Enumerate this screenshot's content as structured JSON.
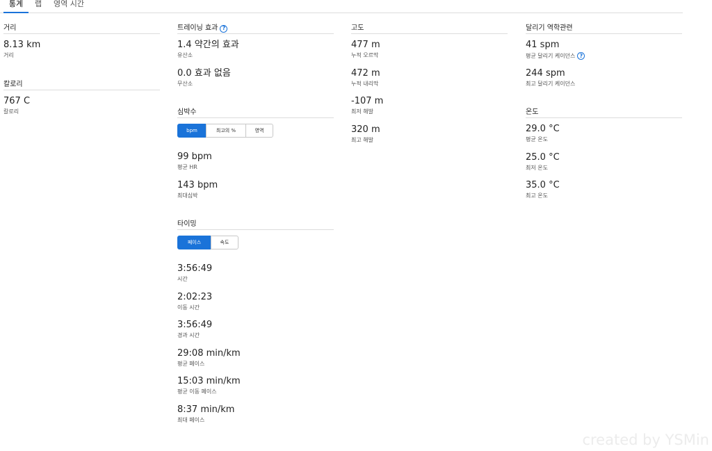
{
  "tabs": [
    {
      "label": "통계",
      "active": true
    },
    {
      "label": "랩",
      "active": false
    },
    {
      "label": "영역 시간",
      "active": false
    }
  ],
  "distance": {
    "title": "거리",
    "value": "8.13 km",
    "label": "거리"
  },
  "calories": {
    "title": "칼로리",
    "value": "767 C",
    "label": "칼로리"
  },
  "training": {
    "title": "트레이닝 효과",
    "help_icon": "question-circle-icon",
    "items": [
      {
        "value": "1.4 약간의 효과",
        "label": "유산소"
      },
      {
        "value": "0.0 효과 없음",
        "label": "무산소"
      }
    ]
  },
  "heart_rate": {
    "title": "심박수",
    "toggle": [
      {
        "label": "bpm",
        "active": true
      },
      {
        "label": "최고의 %",
        "active": false
      },
      {
        "label": "영역",
        "active": false
      }
    ],
    "items": [
      {
        "value": "99 bpm",
        "label": "평균 HR"
      },
      {
        "value": "143 bpm",
        "label": "최대심박"
      }
    ]
  },
  "timing": {
    "title": "타이밍",
    "toggle": [
      {
        "label": "페이스",
        "active": true
      },
      {
        "label": "속도",
        "active": false
      }
    ],
    "items": [
      {
        "value": "3:56:49",
        "label": "시간"
      },
      {
        "value": "2:02:23",
        "label": "이동 시간"
      },
      {
        "value": "3:56:49",
        "label": "경과 시간"
      },
      {
        "value": "29:08 min/km",
        "label": "평균 페이스"
      },
      {
        "value": "15:03 min/km",
        "label": "평균 이동 페이스"
      },
      {
        "value": "8:37 min/km",
        "label": "최대 페이스"
      }
    ]
  },
  "elevation": {
    "title": "고도",
    "items": [
      {
        "value": "477 m",
        "label": "누적 오르막"
      },
      {
        "value": "472 m",
        "label": "누적 내리막"
      },
      {
        "value": "-107 m",
        "label": "최저 해발"
      },
      {
        "value": "320 m",
        "label": "최고 해발"
      }
    ]
  },
  "dynamics": {
    "title": "달리기 역학관련",
    "items": [
      {
        "value": "41 spm",
        "label": "평균 달리기 케이던스"
      },
      {
        "value": "244 spm",
        "label": "최고 달리기 케이던스"
      }
    ]
  },
  "temperature": {
    "title": "온도",
    "items": [
      {
        "value": "29.0 °C",
        "label": "평균 온도"
      },
      {
        "value": "25.0 °C",
        "label": "최저 온도"
      },
      {
        "value": "35.0 °C",
        "label": "최고 온도"
      }
    ]
  },
  "watermark": "created by YSMin",
  "colors": {
    "accent": "#1a73d9",
    "divider": "#dcdcdc"
  }
}
